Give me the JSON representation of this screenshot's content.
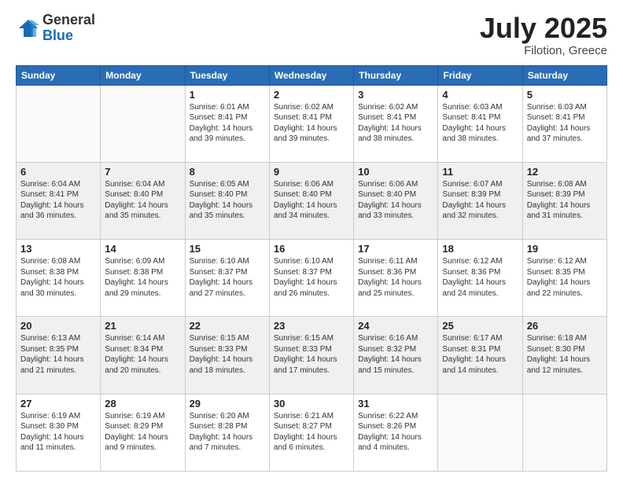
{
  "header": {
    "logo_general": "General",
    "logo_blue": "Blue",
    "month": "July 2025",
    "location": "Filotion, Greece"
  },
  "weekdays": [
    "Sunday",
    "Monday",
    "Tuesday",
    "Wednesday",
    "Thursday",
    "Friday",
    "Saturday"
  ],
  "weeks": [
    [
      {
        "day": "",
        "info": ""
      },
      {
        "day": "",
        "info": ""
      },
      {
        "day": "1",
        "info": "Sunrise: 6:01 AM\nSunset: 8:41 PM\nDaylight: 14 hours and 39 minutes."
      },
      {
        "day": "2",
        "info": "Sunrise: 6:02 AM\nSunset: 8:41 PM\nDaylight: 14 hours and 39 minutes."
      },
      {
        "day": "3",
        "info": "Sunrise: 6:02 AM\nSunset: 8:41 PM\nDaylight: 14 hours and 38 minutes."
      },
      {
        "day": "4",
        "info": "Sunrise: 6:03 AM\nSunset: 8:41 PM\nDaylight: 14 hours and 38 minutes."
      },
      {
        "day": "5",
        "info": "Sunrise: 6:03 AM\nSunset: 8:41 PM\nDaylight: 14 hours and 37 minutes."
      }
    ],
    [
      {
        "day": "6",
        "info": "Sunrise: 6:04 AM\nSunset: 8:41 PM\nDaylight: 14 hours and 36 minutes."
      },
      {
        "day": "7",
        "info": "Sunrise: 6:04 AM\nSunset: 8:40 PM\nDaylight: 14 hours and 35 minutes."
      },
      {
        "day": "8",
        "info": "Sunrise: 6:05 AM\nSunset: 8:40 PM\nDaylight: 14 hours and 35 minutes."
      },
      {
        "day": "9",
        "info": "Sunrise: 6:06 AM\nSunset: 8:40 PM\nDaylight: 14 hours and 34 minutes."
      },
      {
        "day": "10",
        "info": "Sunrise: 6:06 AM\nSunset: 8:40 PM\nDaylight: 14 hours and 33 minutes."
      },
      {
        "day": "11",
        "info": "Sunrise: 6:07 AM\nSunset: 8:39 PM\nDaylight: 14 hours and 32 minutes."
      },
      {
        "day": "12",
        "info": "Sunrise: 6:08 AM\nSunset: 8:39 PM\nDaylight: 14 hours and 31 minutes."
      }
    ],
    [
      {
        "day": "13",
        "info": "Sunrise: 6:08 AM\nSunset: 8:38 PM\nDaylight: 14 hours and 30 minutes."
      },
      {
        "day": "14",
        "info": "Sunrise: 6:09 AM\nSunset: 8:38 PM\nDaylight: 14 hours and 29 minutes."
      },
      {
        "day": "15",
        "info": "Sunrise: 6:10 AM\nSunset: 8:37 PM\nDaylight: 14 hours and 27 minutes."
      },
      {
        "day": "16",
        "info": "Sunrise: 6:10 AM\nSunset: 8:37 PM\nDaylight: 14 hours and 26 minutes."
      },
      {
        "day": "17",
        "info": "Sunrise: 6:11 AM\nSunset: 8:36 PM\nDaylight: 14 hours and 25 minutes."
      },
      {
        "day": "18",
        "info": "Sunrise: 6:12 AM\nSunset: 8:36 PM\nDaylight: 14 hours and 24 minutes."
      },
      {
        "day": "19",
        "info": "Sunrise: 6:12 AM\nSunset: 8:35 PM\nDaylight: 14 hours and 22 minutes."
      }
    ],
    [
      {
        "day": "20",
        "info": "Sunrise: 6:13 AM\nSunset: 8:35 PM\nDaylight: 14 hours and 21 minutes."
      },
      {
        "day": "21",
        "info": "Sunrise: 6:14 AM\nSunset: 8:34 PM\nDaylight: 14 hours and 20 minutes."
      },
      {
        "day": "22",
        "info": "Sunrise: 6:15 AM\nSunset: 8:33 PM\nDaylight: 14 hours and 18 minutes."
      },
      {
        "day": "23",
        "info": "Sunrise: 6:15 AM\nSunset: 8:33 PM\nDaylight: 14 hours and 17 minutes."
      },
      {
        "day": "24",
        "info": "Sunrise: 6:16 AM\nSunset: 8:32 PM\nDaylight: 14 hours and 15 minutes."
      },
      {
        "day": "25",
        "info": "Sunrise: 6:17 AM\nSunset: 8:31 PM\nDaylight: 14 hours and 14 minutes."
      },
      {
        "day": "26",
        "info": "Sunrise: 6:18 AM\nSunset: 8:30 PM\nDaylight: 14 hours and 12 minutes."
      }
    ],
    [
      {
        "day": "27",
        "info": "Sunrise: 6:19 AM\nSunset: 8:30 PM\nDaylight: 14 hours and 11 minutes."
      },
      {
        "day": "28",
        "info": "Sunrise: 6:19 AM\nSunset: 8:29 PM\nDaylight: 14 hours and 9 minutes."
      },
      {
        "day": "29",
        "info": "Sunrise: 6:20 AM\nSunset: 8:28 PM\nDaylight: 14 hours and 7 minutes."
      },
      {
        "day": "30",
        "info": "Sunrise: 6:21 AM\nSunset: 8:27 PM\nDaylight: 14 hours and 6 minutes."
      },
      {
        "day": "31",
        "info": "Sunrise: 6:22 AM\nSunset: 8:26 PM\nDaylight: 14 hours and 4 minutes."
      },
      {
        "day": "",
        "info": ""
      },
      {
        "day": "",
        "info": ""
      }
    ]
  ]
}
